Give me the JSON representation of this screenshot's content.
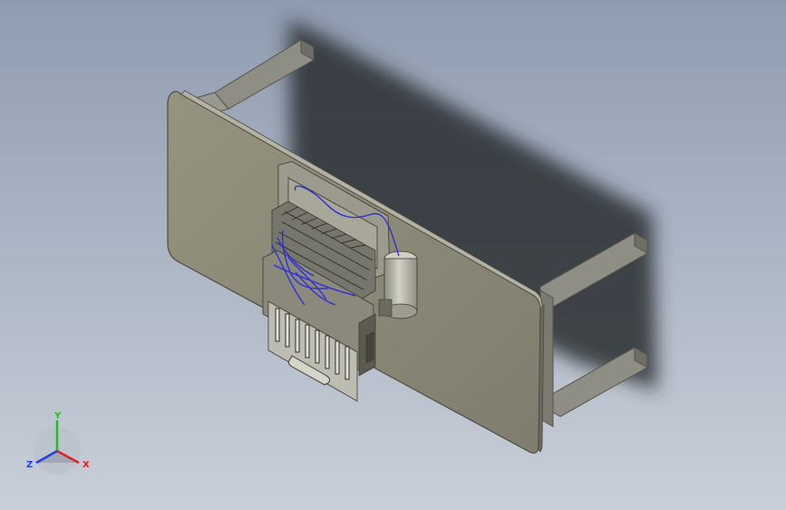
{
  "viewport": {
    "background": {
      "top": "#8f9cb0",
      "bottom": "#c9cfd8"
    }
  },
  "model": {
    "plate_color": "#8c8a78",
    "plate_edge_color": "#55544a",
    "frame_color": "#8b8a80",
    "shadow_color": "#2b2d31",
    "wire_color": "#2a2adf",
    "cylinder_color": "#bdbcb0"
  },
  "triad": {
    "axes": [
      {
        "name": "y",
        "label": "Y",
        "color": "#1fbf1f"
      },
      {
        "name": "x",
        "label": "X",
        "color": "#e02020"
      },
      {
        "name": "z",
        "label": "Z",
        "color": "#2040e0"
      }
    ]
  }
}
